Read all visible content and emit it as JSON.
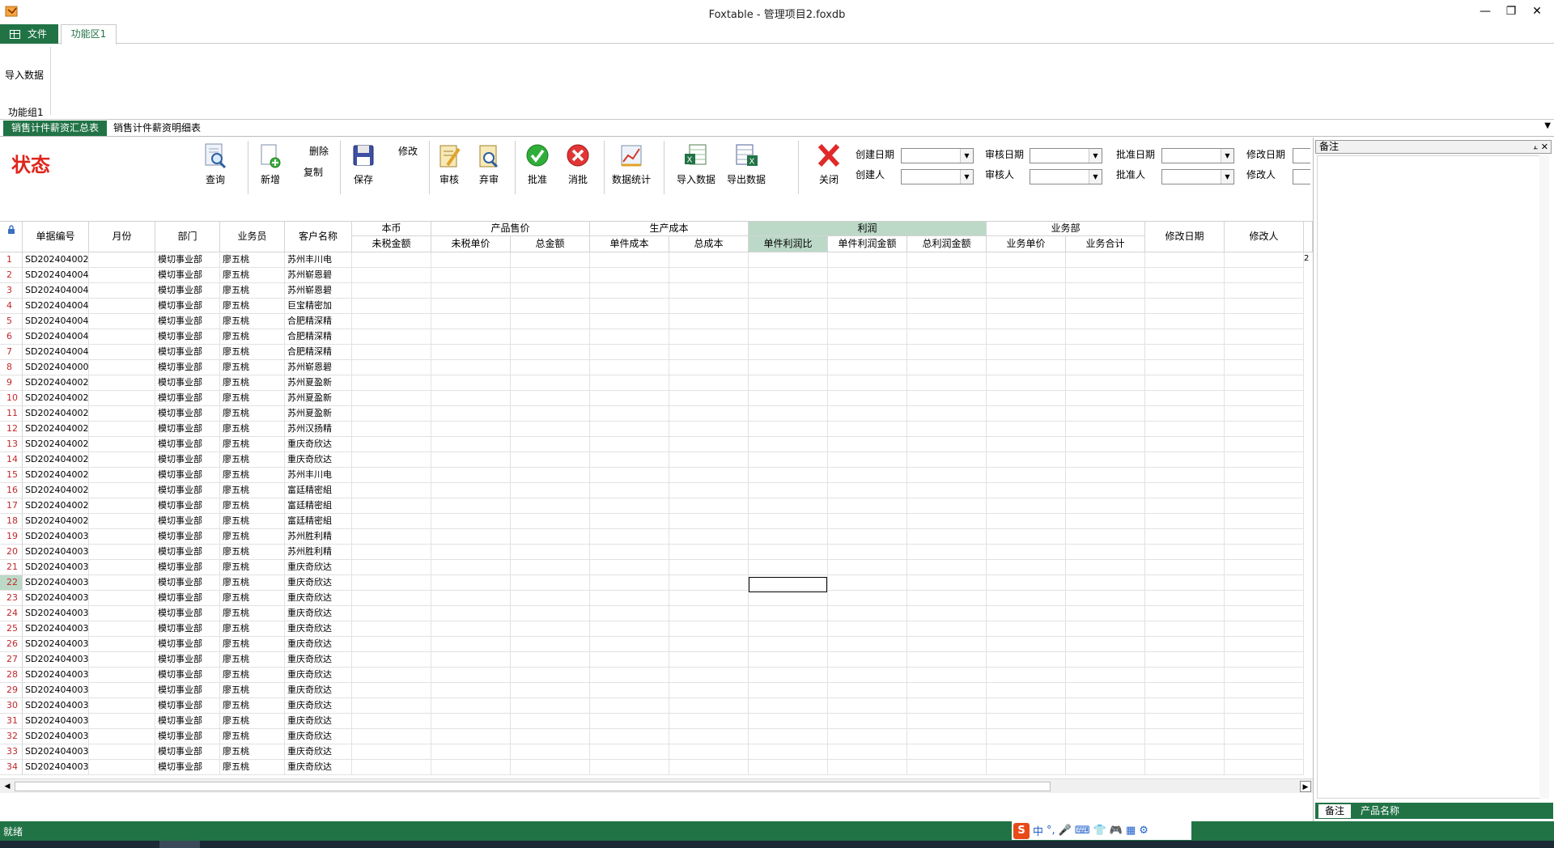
{
  "window": {
    "title": "Foxtable - 管理项目2.foxdb",
    "min_glyph": "—",
    "restore_glyph": "❐",
    "close_glyph": "✕"
  },
  "ribbon": {
    "file_tab": "文件",
    "func_tab": "功能区1",
    "import_btn": "导入数据",
    "group_label": "功能组1"
  },
  "doc_tabs": {
    "active": "销售计件薪资汇总表",
    "other": "销售计件薪资明细表",
    "menu": "▼"
  },
  "toolbar": {
    "status_label": "状态",
    "query": "查询",
    "add": "新增",
    "delete": "删除",
    "copy": "复制",
    "save": "保存",
    "modify": "修改",
    "audit": "审核",
    "abandon": "弃审",
    "approve": "批准",
    "cancel_approve": "消批",
    "stats": "数据统计",
    "import": "导入数据",
    "export": "导出数据",
    "close": "关闭",
    "fields": {
      "create_date": "创建日期",
      "creator": "创建人",
      "audit_date": "审核日期",
      "auditor": "审核人",
      "approve_date": "批准日期",
      "approver": "批准人",
      "modify_date": "修改日期",
      "modifier": "修改人"
    }
  },
  "grid": {
    "headers": {
      "doc_no": "单据编号",
      "month": "月份",
      "dept": "部门",
      "salesman": "业务员",
      "customer": "客户名称",
      "local_currency": "本币",
      "net_amount": "未税金额",
      "product_price": "产品售价",
      "net_unit_price": "未税单价",
      "total_amount": "总金额",
      "production_cost": "生产成本",
      "unit_cost": "单件成本",
      "total_cost": "总成本",
      "profit": "利润",
      "unit_profit_ratio": "单件利润比",
      "unit_profit_amount": "单件利润金额",
      "total_profit_amount": "总利润金额",
      "sales_dept": "业务部",
      "sales_unit_price": "业务单价",
      "sales_total": "业务合计",
      "modify_date": "修改日期",
      "modifier": "修改人"
    },
    "overflow_mark": "2",
    "rows": [
      {
        "n": "1",
        "doc": "SD202404002",
        "dept": "模切事业部",
        "person": "廖五桃",
        "cust": "苏州丰川电"
      },
      {
        "n": "2",
        "doc": "SD202404004",
        "dept": "模切事业部",
        "person": "廖五桃",
        "cust": "苏州崭恩碧"
      },
      {
        "n": "3",
        "doc": "SD202404004",
        "dept": "模切事业部",
        "person": "廖五桃",
        "cust": "苏州崭恩碧"
      },
      {
        "n": "4",
        "doc": "SD202404004",
        "dept": "模切事业部",
        "person": "廖五桃",
        "cust": "巨宝精密加"
      },
      {
        "n": "5",
        "doc": "SD202404004",
        "dept": "模切事业部",
        "person": "廖五桃",
        "cust": "合肥精深精"
      },
      {
        "n": "6",
        "doc": "SD202404004",
        "dept": "模切事业部",
        "person": "廖五桃",
        "cust": "合肥精深精"
      },
      {
        "n": "7",
        "doc": "SD202404004",
        "dept": "模切事业部",
        "person": "廖五桃",
        "cust": "合肥精深精"
      },
      {
        "n": "8",
        "doc": "SD202404000",
        "dept": "模切事业部",
        "person": "廖五桃",
        "cust": "苏州崭恩碧"
      },
      {
        "n": "9",
        "doc": "SD202404002",
        "dept": "模切事业部",
        "person": "廖五桃",
        "cust": "苏州夏盈新"
      },
      {
        "n": "10",
        "doc": "SD202404002",
        "dept": "模切事业部",
        "person": "廖五桃",
        "cust": "苏州夏盈新"
      },
      {
        "n": "11",
        "doc": "SD202404002",
        "dept": "模切事业部",
        "person": "廖五桃",
        "cust": "苏州夏盈新"
      },
      {
        "n": "12",
        "doc": "SD202404002",
        "dept": "模切事业部",
        "person": "廖五桃",
        "cust": "苏州汉扬精"
      },
      {
        "n": "13",
        "doc": "SD202404002",
        "dept": "模切事业部",
        "person": "廖五桃",
        "cust": "重庆奇欣达"
      },
      {
        "n": "14",
        "doc": "SD202404002",
        "dept": "模切事业部",
        "person": "廖五桃",
        "cust": "重庆奇欣达"
      },
      {
        "n": "15",
        "doc": "SD202404002",
        "dept": "模切事业部",
        "person": "廖五桃",
        "cust": "苏州丰川电"
      },
      {
        "n": "16",
        "doc": "SD202404002",
        "dept": "模切事业部",
        "person": "廖五桃",
        "cust": "富廷精密組"
      },
      {
        "n": "17",
        "doc": "SD202404002",
        "dept": "模切事业部",
        "person": "廖五桃",
        "cust": "富廷精密組"
      },
      {
        "n": "18",
        "doc": "SD202404002",
        "dept": "模切事业部",
        "person": "廖五桃",
        "cust": "富廷精密組"
      },
      {
        "n": "19",
        "doc": "SD202404003",
        "dept": "模切事业部",
        "person": "廖五桃",
        "cust": "苏州胜利精"
      },
      {
        "n": "20",
        "doc": "SD202404003",
        "dept": "模切事业部",
        "person": "廖五桃",
        "cust": "苏州胜利精"
      },
      {
        "n": "21",
        "doc": "SD202404003",
        "dept": "模切事业部",
        "person": "廖五桃",
        "cust": "重庆奇欣达"
      },
      {
        "n": "22",
        "doc": "SD202404003",
        "dept": "模切事业部",
        "person": "廖五桃",
        "cust": "重庆奇欣达"
      },
      {
        "n": "23",
        "doc": "SD202404003",
        "dept": "模切事业部",
        "person": "廖五桃",
        "cust": "重庆奇欣达"
      },
      {
        "n": "24",
        "doc": "SD202404003",
        "dept": "模切事业部",
        "person": "廖五桃",
        "cust": "重庆奇欣达"
      },
      {
        "n": "25",
        "doc": "SD202404003",
        "dept": "模切事业部",
        "person": "廖五桃",
        "cust": "重庆奇欣达"
      },
      {
        "n": "26",
        "doc": "SD202404003",
        "dept": "模切事业部",
        "person": "廖五桃",
        "cust": "重庆奇欣达"
      },
      {
        "n": "27",
        "doc": "SD202404003",
        "dept": "模切事业部",
        "person": "廖五桃",
        "cust": "重庆奇欣达"
      },
      {
        "n": "28",
        "doc": "SD202404003",
        "dept": "模切事业部",
        "person": "廖五桃",
        "cust": "重庆奇欣达"
      },
      {
        "n": "29",
        "doc": "SD202404003",
        "dept": "模切事业部",
        "person": "廖五桃",
        "cust": "重庆奇欣达"
      },
      {
        "n": "30",
        "doc": "SD202404003",
        "dept": "模切事业部",
        "person": "廖五桃",
        "cust": "重庆奇欣达"
      },
      {
        "n": "31",
        "doc": "SD202404003",
        "dept": "模切事业部",
        "person": "廖五桃",
        "cust": "重庆奇欣达"
      },
      {
        "n": "32",
        "doc": "SD202404003",
        "dept": "模切事业部",
        "person": "廖五桃",
        "cust": "重庆奇欣达"
      },
      {
        "n": "33",
        "doc": "SD202404003",
        "dept": "模切事业部",
        "person": "廖五桃",
        "cust": "重庆奇欣达"
      },
      {
        "n": "34",
        "doc": "SD202404003",
        "dept": "模切事业部",
        "person": "廖五桃",
        "cust": "重庆奇欣达"
      }
    ],
    "selected_row": "22"
  },
  "right_panel": {
    "title": "备注",
    "pin": "⫠",
    "close": "✕",
    "tab_active": "备注",
    "tab_other": "产品名称"
  },
  "statusbar": {
    "text": "就绪",
    "ime_logo": "S",
    "ime_mode": "中"
  },
  "colors": {
    "accent": "#217346",
    "status_red": "#e0241b",
    "row_number": "#c0282b",
    "highlight": "#bcd9c7"
  }
}
